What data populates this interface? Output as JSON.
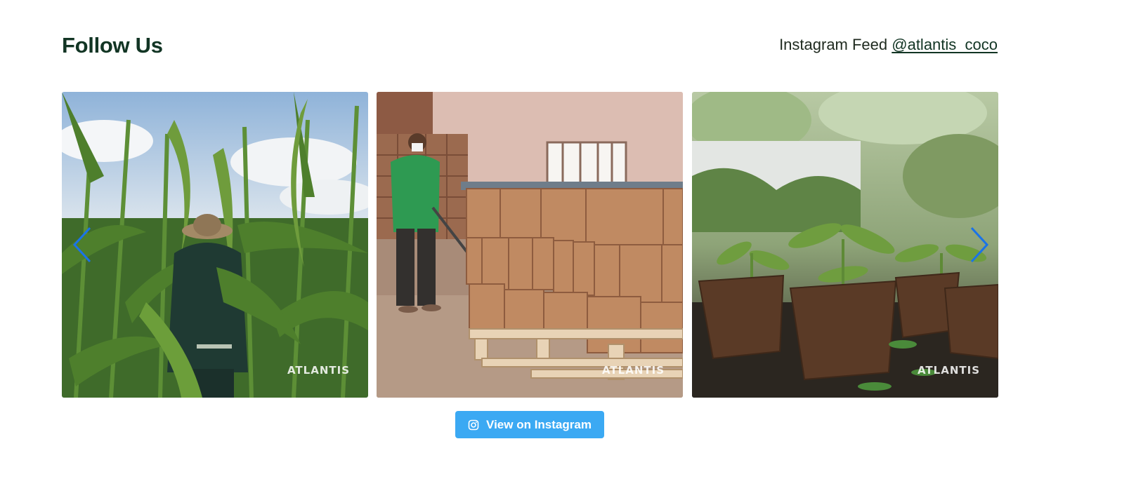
{
  "header": {
    "title": "Follow Us",
    "feed_prefix": "Instagram Feed ",
    "handle": "@atlantis_coco"
  },
  "gallery": {
    "images": [
      {
        "watermark": "ATLANTIS"
      },
      {
        "watermark": "ATLANTIS"
      },
      {
        "watermark": "ATLANTIS"
      }
    ],
    "prev_icon": "chevron-left-icon",
    "next_icon": "chevron-right-icon",
    "nav_color": "#1a73e8"
  },
  "cta": {
    "label": "View on Instagram",
    "icon": "instagram-icon",
    "color": "#3ba9f3"
  },
  "colors": {
    "title": "#123524",
    "background": "#ffffff"
  }
}
